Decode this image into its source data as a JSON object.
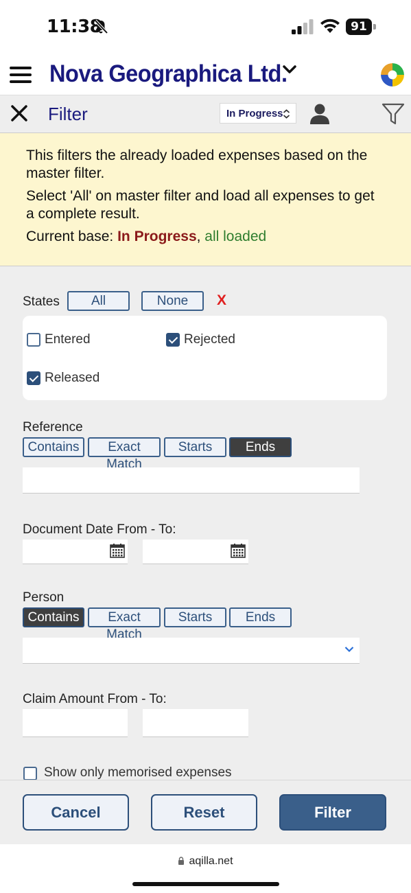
{
  "status_bar": {
    "time": "11:38",
    "battery": "91"
  },
  "header": {
    "company": "Nova Geographica Ltd."
  },
  "filter_bar": {
    "title": "Filter",
    "status_value": "In Progress"
  },
  "info": {
    "line1": "This filters the already loaded expenses based on the master filter.",
    "line2": "Select 'All' on master filter and load all expenses to get a complete result.",
    "base_prefix": "Current base: ",
    "base_state": "In Progress",
    "base_sep": ", ",
    "base_load": "all loaded"
  },
  "states": {
    "label": "States",
    "all_label": "All",
    "none_label": "None",
    "clear_label": "X",
    "items": [
      {
        "label": "Entered",
        "checked": false
      },
      {
        "label": "Rejected",
        "checked": true
      },
      {
        "label": "Released",
        "checked": true
      }
    ]
  },
  "reference": {
    "label": "Reference",
    "modes": [
      "Contains",
      "Exact Match",
      "Starts",
      "Ends"
    ],
    "active_mode": "Ends",
    "value": ""
  },
  "document_date": {
    "label": "Document Date From - To:",
    "from": "",
    "to": ""
  },
  "person": {
    "label": "Person",
    "modes": [
      "Contains",
      "Exact Match",
      "Starts",
      "Ends"
    ],
    "active_mode": "Contains",
    "value": ""
  },
  "claim_amount": {
    "label": "Claim Amount From - To:",
    "from": "",
    "to": ""
  },
  "memorised": {
    "label": "Show only memorised expenses",
    "checked": false
  },
  "actions": {
    "cancel": "Cancel",
    "reset": "Reset",
    "filter": "Filter"
  },
  "browser": {
    "url": "aqilla.net"
  },
  "colors": {
    "brand_navy": "#1a1a7e",
    "button_blue": "#3a5f8a",
    "info_bg": "#fdf6cf",
    "clear_red": "#e02020"
  }
}
